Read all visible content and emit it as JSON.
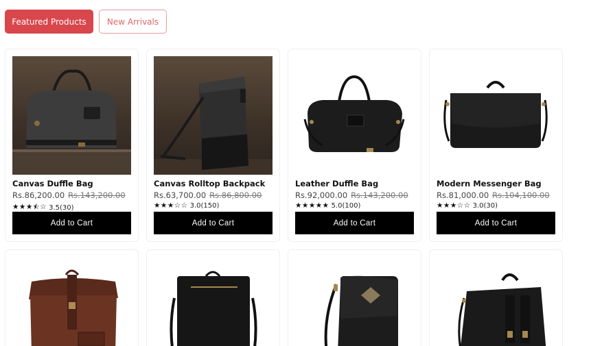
{
  "tabs": [
    {
      "label": "Featured Products",
      "active": true
    },
    {
      "label": "New Arrivals",
      "active": false
    }
  ],
  "colors": {
    "accent": "#d9474d",
    "button": "#000000"
  },
  "products": [
    {
      "name": "Canvas Duffle Bag",
      "price": "Rs.86,200.00",
      "old_price": "Rs.143,200.00",
      "stars": "★★★⯪☆",
      "rating": "3.5(30)",
      "cart_label": "Add to Cart"
    },
    {
      "name": "Canvas Rolltop Backpack",
      "price": "Rs.63,700.00",
      "old_price": "Rs.86,800.00",
      "stars": "★★★☆☆",
      "rating": "3.0(150)",
      "cart_label": "Add to Cart"
    },
    {
      "name": "Leather Duffle Bag",
      "price": "Rs.92,000.00",
      "old_price": "Rs.143,200.00",
      "stars": "★★★★★",
      "rating": "5.0(100)",
      "cart_label": "Add to Cart"
    },
    {
      "name": "Modern Messenger Bag",
      "price": "Rs.81,000.00",
      "old_price": "Rs.104,100.00",
      "stars": "★★★☆☆",
      "rating": "3.0(30)",
      "cart_label": "Add to Cart"
    }
  ],
  "row2_products": [
    {
      "image": "brown-rolltop-backpack"
    },
    {
      "image": "black-zip-backpack"
    },
    {
      "image": "black-flat-messenger"
    },
    {
      "image": "black-buckle-satchel"
    }
  ]
}
